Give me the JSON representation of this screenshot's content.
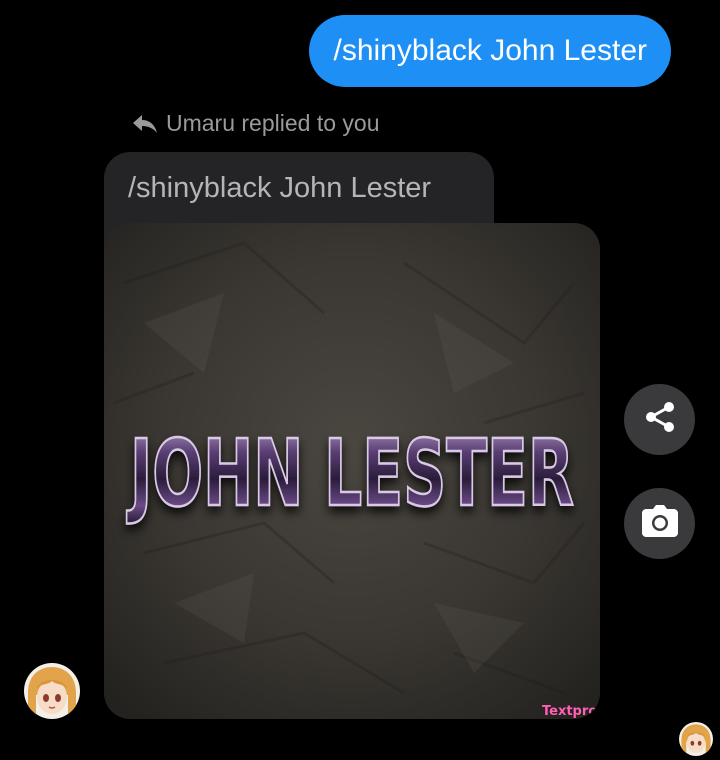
{
  "sent_message": {
    "text": "/shinyblack John Lester"
  },
  "reply": {
    "note": "Umaru replied to you",
    "quoted_text": "/shinyblack John Lester",
    "image": {
      "headline": "JOHN LESTER",
      "watermark": "Textpro.m"
    }
  },
  "actions": {
    "share_icon": "share-icon",
    "camera_icon": "camera-icon"
  },
  "colors": {
    "sent_bubble": "#1E90F5",
    "background": "#000000",
    "quoted_bubble": "#242426",
    "action_button": "#3a3a3c",
    "watermark": "#ff5fb5"
  }
}
